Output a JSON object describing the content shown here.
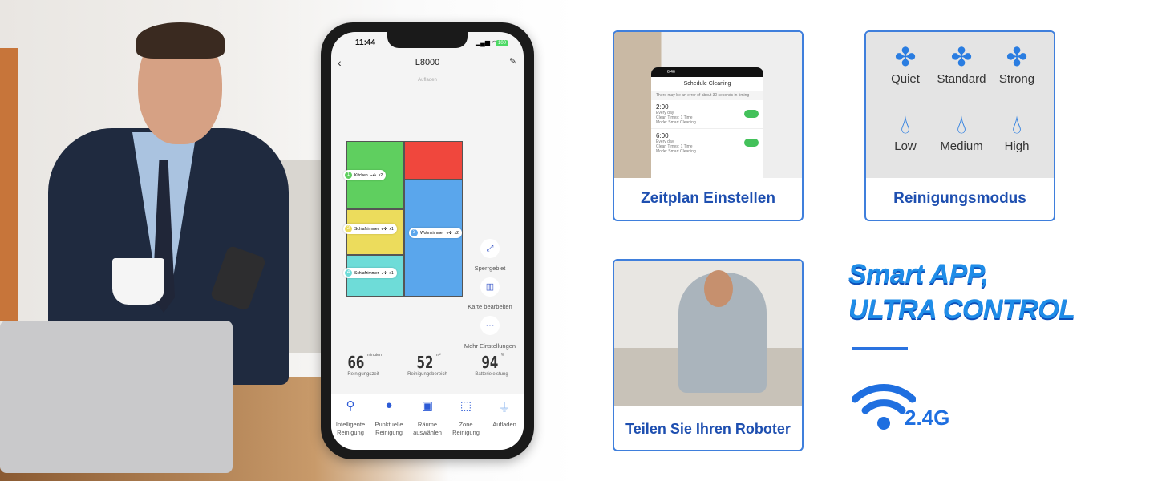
{
  "phone": {
    "status_time": "11:44",
    "battery": "100",
    "device_name": "L8000",
    "device_status": "Aufladen",
    "rooms": [
      {
        "number": "1",
        "name": "Kitchen",
        "passes": "x2",
        "color": "#5fcf5f"
      },
      {
        "number": "2",
        "name": "Schlafzimmer",
        "passes": "x1",
        "color": "#ecdc5c"
      },
      {
        "number": "3",
        "name": "Wohnzimmer",
        "passes": "x2",
        "color": "#5aa6ec"
      },
      {
        "number": "4",
        "name": "Schlafzimmer",
        "passes": "x1",
        "color": "#6edcd8"
      },
      {
        "number": "",
        "name": "",
        "passes": "",
        "color": "#f0473d"
      }
    ],
    "side_actions": [
      {
        "label": "Sperrgebiet",
        "icon": "restricted-area-icon"
      },
      {
        "label": "Karte bearbeiten",
        "icon": "map-edit-icon"
      },
      {
        "label": "Mehr Einstellungen",
        "icon": "more-icon"
      }
    ],
    "stats": [
      {
        "value": "66",
        "unit": "minuten",
        "label": "Reinigungszeit"
      },
      {
        "value": "52",
        "unit": "m²",
        "label": "Reinigungsbereich"
      },
      {
        "value": "94",
        "unit": "%",
        "label": "Batterieleistung"
      }
    ],
    "bottom_nav": [
      {
        "label": "Intelligente Reinigung",
        "icon": "broom-icon"
      },
      {
        "label": "Punktuelle Reinigung",
        "icon": "location-pin-icon"
      },
      {
        "label": "Räume auswählen",
        "icon": "room-select-icon"
      },
      {
        "label": "Zone Reinigung",
        "icon": "zone-icon"
      },
      {
        "label": "Aufladen",
        "icon": "plug-icon"
      }
    ]
  },
  "schedule_card": {
    "label": "Zeitplan Einstellen",
    "screen_time": "6:46",
    "screen_title": "Schedule Cleaning",
    "notice": "There may be an error of about 30 seconds in timing",
    "entries": [
      {
        "time": "2:00",
        "repeat": "Every day",
        "times": "Clean Times: 1 Time",
        "mode": "Mode: Smart Cleaning",
        "enabled": true
      },
      {
        "time": "6:00",
        "repeat": "Every day",
        "times": "Clean Times: 1 Time",
        "mode": "Mode: Smart Cleaning",
        "enabled": true
      }
    ]
  },
  "mode_card": {
    "label": "Reinigungsmodus",
    "suction": [
      "Quiet",
      "Standard",
      "Strong"
    ],
    "water": [
      "Low",
      "Medium",
      "High"
    ]
  },
  "share_card": {
    "label": "Teilen Sie Ihren Roboter"
  },
  "headline": {
    "line1": "Smart APP,",
    "line2": "ULTRA CONTROL"
  },
  "wifi": {
    "band": "2.4G"
  },
  "colors": {
    "accent": "#1f6fe0",
    "card_border": "#3f7fdc"
  }
}
